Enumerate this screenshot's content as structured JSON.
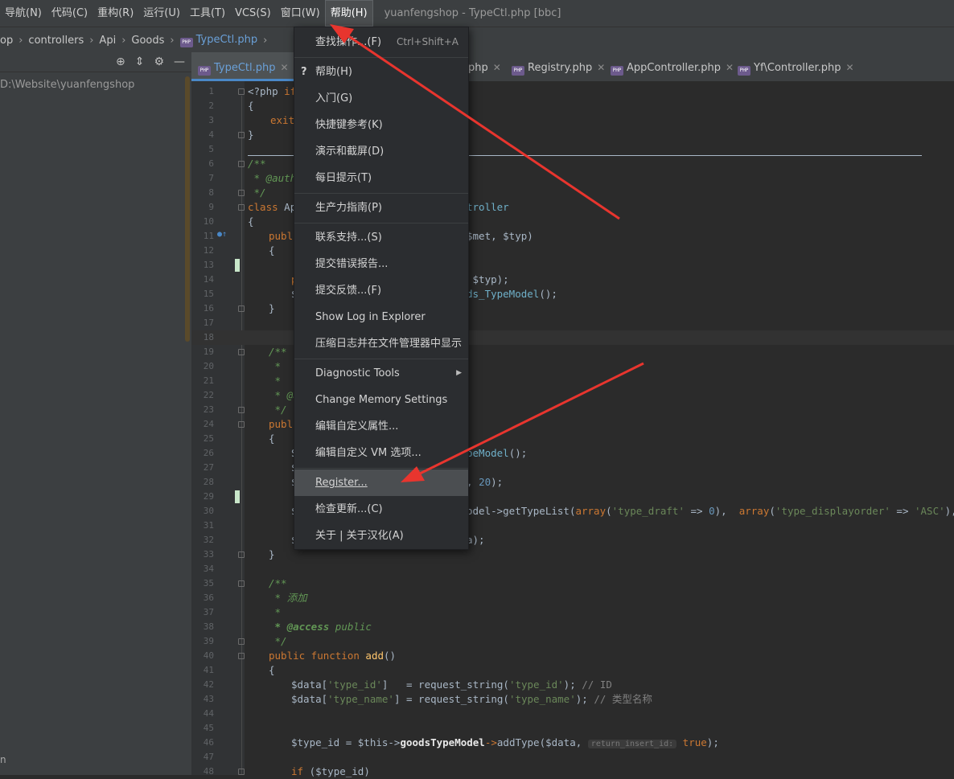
{
  "menubar": {
    "items": [
      "导航(N)",
      "代码(C)",
      "重构(R)",
      "运行(U)",
      "工具(T)",
      "VCS(S)",
      "窗口(W)",
      "帮助(H)"
    ],
    "window_title": "yuanfengshop - TypeCtl.php [bbc]"
  },
  "breadcrumb": {
    "items": [
      "op",
      "controllers",
      "Api",
      "Goods",
      "TypeCtl.php"
    ],
    "badge": "PHP"
  },
  "project": {
    "root": "D:\\Website\\yuanfengshop",
    "bottom_text": "n"
  },
  "tabs": [
    {
      "label": "TypeCtl.php"
    },
    {
      "label": "php"
    },
    {
      "label": "Registry.php"
    },
    {
      "label": "AppController.php"
    },
    {
      "label": "Yf\\Controller.php"
    }
  ],
  "editor": {
    "line_numbers": [
      "1",
      "2",
      "3",
      "4",
      "5",
      "6",
      "7",
      "8",
      "9",
      "10",
      "11",
      "12",
      "13",
      "14",
      "15",
      "16",
      "17",
      "18",
      "19",
      "20",
      "21",
      "22",
      "23",
      "24",
      "25",
      "26",
      "27",
      "28",
      "29",
      "30",
      "31",
      "32",
      "33",
      "34",
      "35",
      "36",
      "37",
      "38",
      "39",
      "40",
      "41",
      "42",
      "43",
      "44",
      "45",
      "46",
      "47",
      "48"
    ],
    "lines": {
      "l1a": "<?php ",
      "l1b": "if",
      "l2": "{",
      "l3": "exit",
      "l4": "}",
      "l6": "/**",
      "l7": " * @autho",
      "l8": " */",
      "l9a": "class",
      "l9b": " Api",
      "l9c": "troller",
      "l10": "{",
      "l11a": "publi",
      "l11b": "$met, $typ)",
      "l12": "{",
      "l14a": "p",
      "l14b": " $typ);",
      "l15a": "$",
      "l15b": "ds_TypeModel",
      "l15c": "();",
      "l16": "}",
      "l19": "/**",
      "l20": " *",
      "l21": " *",
      "l22": " * @a",
      "l23": " */",
      "l24": "publi",
      "l25": "{",
      "l26a": "S",
      "l26b": "peModel",
      "l26c": "();",
      "l27": "$",
      "l28a": "$",
      "l28b": ", ",
      "l28c": "20",
      "l28d": ");",
      "l30a": "$",
      "l30b": "odel->",
      "l30c": "getTypeList",
      "l30d": "(",
      "l30e": "array",
      "l30f": "(",
      "l30g": "'type_draft'",
      "l30h": " => ",
      "l30i": "0",
      "l30j": "),  ",
      "l30k": "array",
      "l30l": "(",
      "l30m": "'type_displayorder'",
      "l30n": " => ",
      "l30o": "'ASC'",
      "l30p": "), $page",
      "l32a": "$",
      "l32b": "a);",
      "l33": "}",
      "l35": "/**",
      "l36": " * 添加",
      "l37": " *",
      "l38a": " * @access",
      "l38b": " public",
      "l39": " */",
      "l40a": "public function ",
      "l40b": "add",
      "l40c": "()",
      "l41": "{",
      "l42a": "$data[",
      "l42b": "'type_id'",
      "l42c": "]   = request_string(",
      "l42d": "'type_id'",
      "l42e": "); ",
      "l42f": "// ID",
      "l43a": "$data[",
      "l43b": "'type_name'",
      "l43c": "] = request_string(",
      "l43d": "'type_name'",
      "l43e": "); ",
      "l43f": "// 类型名称",
      "l46a": "$type_id = $this->",
      "l46b": "goodsTypeModel",
      "l46c": "->",
      "l46d": "addType",
      "l46e": "($data, ",
      "l46f": "return_insert_id:",
      "l46g": " true",
      "l46h": ");",
      "l48a": "if",
      "l48b": " ($type_id)"
    }
  },
  "help_menu": {
    "items": [
      {
        "label": "查找操作...(F)",
        "shortcut": "Ctrl+Shift+A"
      },
      {
        "label": "帮助(H)",
        "icon": "?"
      },
      {
        "label": "入门(G)"
      },
      {
        "label": "快捷键参考(K)"
      },
      {
        "label": "演示和截屏(D)"
      },
      {
        "label": "每日提示(T)"
      },
      {
        "label": "生产力指南(P)"
      },
      {
        "label": "联系支持...(S)"
      },
      {
        "label": "提交错误报告..."
      },
      {
        "label": "提交反馈...(F)"
      },
      {
        "label": "Show Log in Explorer"
      },
      {
        "label": "压缩日志并在文件管理器中显示"
      },
      {
        "label": "Diagnostic Tools"
      },
      {
        "label": "Change Memory Settings"
      },
      {
        "label": "编辑自定义属性..."
      },
      {
        "label": "编辑自定义 VM 选项..."
      },
      {
        "label": "Register..."
      },
      {
        "label": "检查更新...(C)"
      },
      {
        "label": "关于 | 关于汉化(A)"
      }
    ],
    "submenu_arrow": "▶",
    "selected": "Register..."
  },
  "colors": {
    "annotation_arrow": "#e8352e",
    "menu_bg": "#2b2d30",
    "editor_bg": "#2b2b2b"
  }
}
